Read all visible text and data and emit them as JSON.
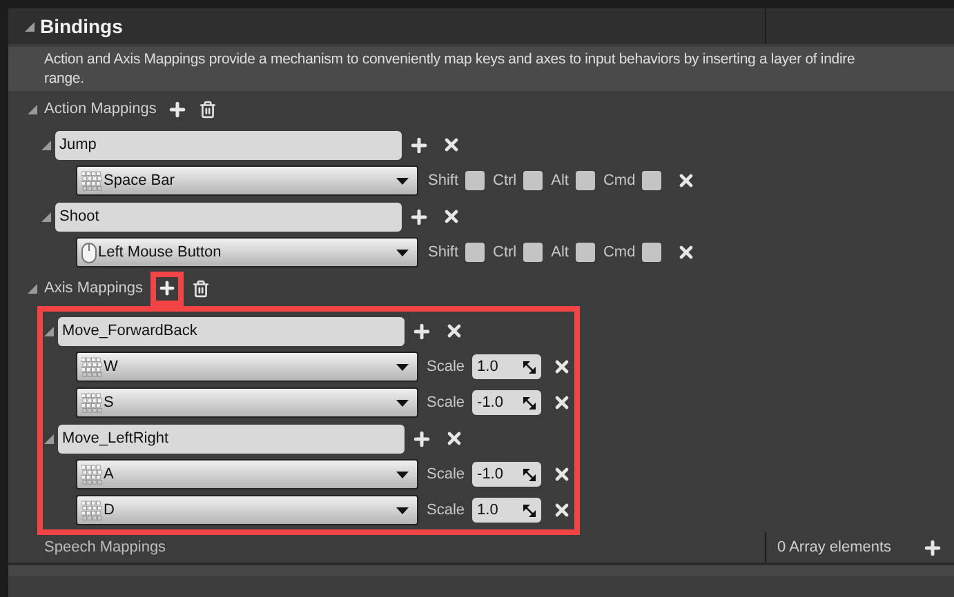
{
  "panel": {
    "title": "Bindings",
    "description": [
      "Action and Axis Mappings provide a mechanism to conveniently map keys and axes to input behaviors by inserting a layer of indire",
      "range."
    ]
  },
  "action_mappings": {
    "label": "Action Mappings",
    "expanded": true,
    "mappings": [
      {
        "name": "Jump",
        "expanded": true,
        "keys": [
          {
            "key": "Space Bar",
            "kind": "keyboard",
            "modifiers": [
              {
                "label": "Shift",
                "checked": false
              },
              {
                "label": "Ctrl",
                "checked": false
              },
              {
                "label": "Alt",
                "checked": false
              },
              {
                "label": "Cmd",
                "checked": false
              }
            ]
          }
        ]
      },
      {
        "name": "Shoot",
        "expanded": true,
        "keys": [
          {
            "key": "Left Mouse Button",
            "kind": "mouse",
            "modifiers": [
              {
                "label": "Shift",
                "checked": false
              },
              {
                "label": "Ctrl",
                "checked": false
              },
              {
                "label": "Alt",
                "checked": false
              },
              {
                "label": "Cmd",
                "checked": false
              }
            ]
          }
        ]
      }
    ]
  },
  "axis_mappings": {
    "label": "Axis Mappings",
    "expanded": true,
    "highlighted": true,
    "add_highlighted": true,
    "mappings": [
      {
        "name": "Move_ForwardBack",
        "expanded": true,
        "keys": [
          {
            "key": "W",
            "kind": "keyboard",
            "scale_label": "Scale",
            "scale": "1.0"
          },
          {
            "key": "S",
            "kind": "keyboard",
            "scale_label": "Scale",
            "scale": "-1.0"
          }
        ]
      },
      {
        "name": "Move_LeftRight",
        "expanded": true,
        "keys": [
          {
            "key": "A",
            "kind": "keyboard",
            "scale_label": "Scale",
            "scale": "-1.0"
          },
          {
            "key": "D",
            "kind": "keyboard",
            "scale_label": "Scale",
            "scale": "1.0"
          }
        ]
      }
    ]
  },
  "speech_mappings": {
    "label": "Speech Mappings",
    "count": "0 Array elements"
  }
}
